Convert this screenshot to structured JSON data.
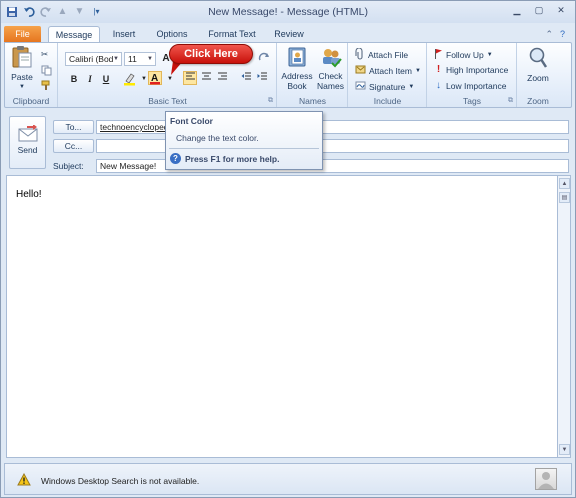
{
  "window": {
    "title": "New Message!  -  Message (HTML)",
    "controls": [
      "minimize",
      "maximize",
      "close"
    ]
  },
  "quick_access": [
    "save-icon",
    "undo-icon",
    "redo-icon",
    "up-icon",
    "down-icon",
    "customize-icon"
  ],
  "tabs": [
    {
      "label": "File"
    },
    {
      "label": "Message"
    },
    {
      "label": "Insert"
    },
    {
      "label": "Options"
    },
    {
      "label": "Format Text"
    },
    {
      "label": "Review"
    }
  ],
  "ribbon": {
    "clipboard": {
      "paste": "Paste",
      "label": "Clipboard"
    },
    "basic_text": {
      "font": "Calibri (Bod",
      "size": "11",
      "label": "Basic Text"
    },
    "names": {
      "address_book_1": "Address",
      "address_book_2": "Book",
      "check_names_1": "Check",
      "check_names_2": "Names",
      "label": "Names"
    },
    "include": {
      "attach_file": "Attach File",
      "attach_item": "Attach Item",
      "signature": "Signature",
      "label": "Include"
    },
    "tags": {
      "follow_up": "Follow Up",
      "high": "High Importance",
      "low": "Low Importance",
      "label": "Tags"
    },
    "zoom": {
      "button": "Zoom",
      "label": "Zoom"
    }
  },
  "callout": {
    "text": "Click Here"
  },
  "tooltip": {
    "title": "Font Color",
    "body": "Change the text color.",
    "help": "Press F1 for more help."
  },
  "message": {
    "send": "Send",
    "to_label": "To...",
    "to_value": "technoencyclopedia",
    "cc_label": "Cc...",
    "cc_value": "",
    "subject_label": "Subject:",
    "subject_value": "New Message!",
    "body": "Hello!"
  },
  "status": {
    "text": "Windows Desktop Search is not available."
  },
  "colors": {
    "file_tab": "#e5731d",
    "callout": "#c8110b",
    "font_color_bar": "#e02020"
  }
}
